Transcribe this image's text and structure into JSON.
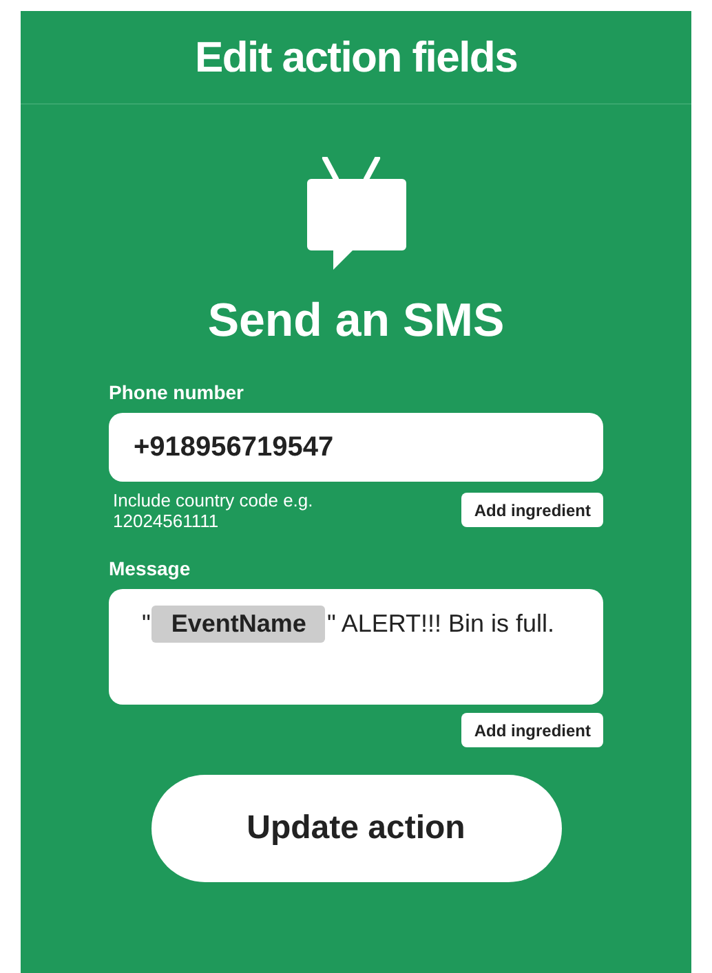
{
  "header": {
    "title": "Edit action fields"
  },
  "action": {
    "title": "Send an SMS"
  },
  "fields": [
    {
      "label": "Phone number",
      "value": [
        {
          "kind": "text",
          "text": "+918956719547"
        }
      ],
      "helper": "Include country code e.g. 12024561111",
      "button": "Add ingredient",
      "kind": "single"
    },
    {
      "label": "Message",
      "value": [
        {
          "kind": "text",
          "text": "\""
        },
        {
          "kind": "ingredient",
          "text": "EventName"
        },
        {
          "kind": "text",
          "text": "\" ALERT!!! Bin is full."
        }
      ],
      "button": "Add ingredient",
      "kind": "multi"
    }
  ],
  "submit": "Update action"
}
